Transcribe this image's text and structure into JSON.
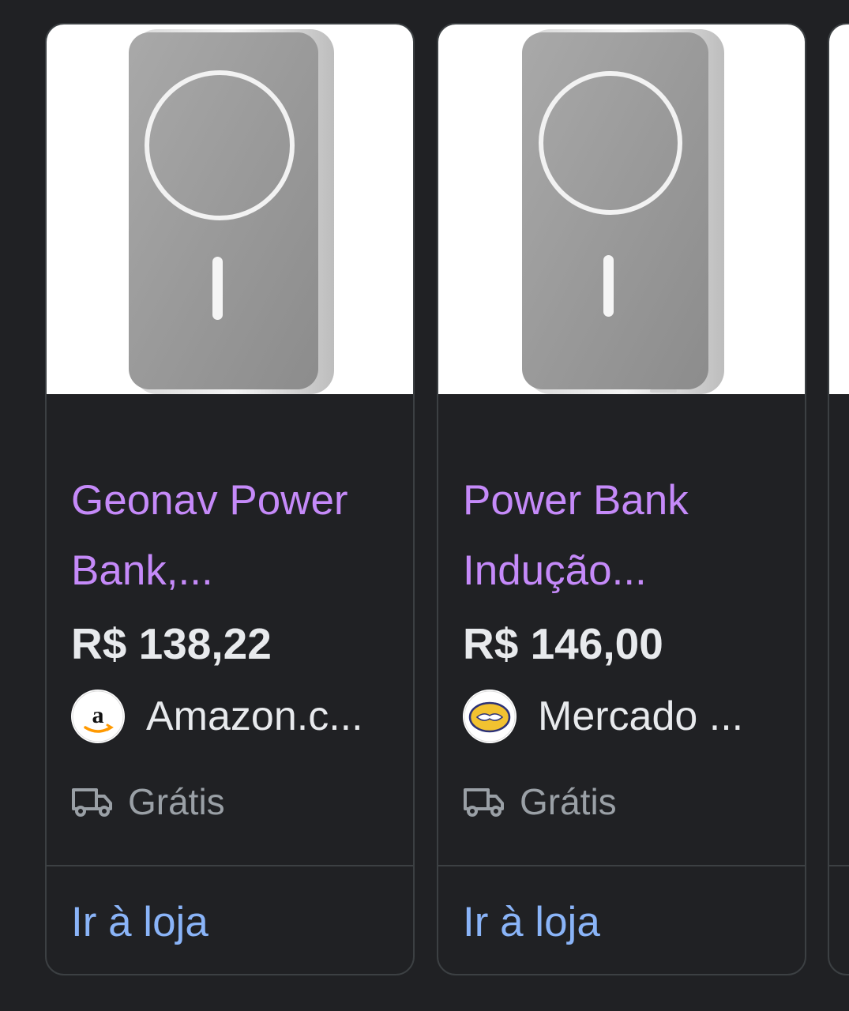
{
  "products": [
    {
      "title_line1": "Geonav Power",
      "title_line2": "Bank,...",
      "price": "R$ 138,22",
      "merchant": "Amazon.c...",
      "merchant_logo": "amazon-logo",
      "shipping": "Grátis",
      "cta": "Ir à loja"
    },
    {
      "title_line1": "Power Bank",
      "title_line2": "Indução...",
      "price": "R$ 146,00",
      "merchant": "Mercado ...",
      "merchant_logo": "mercado-livre-logo",
      "shipping": "Grátis",
      "cta": "Ir à loja"
    }
  ],
  "colors": {
    "background": "#202124",
    "card_border": "#3c4043",
    "title": "#c58af9",
    "price": "#e8eaed",
    "secondary_text": "#9aa0a6",
    "link": "#8ab4f8"
  },
  "icons": {
    "shipping": "truck-icon"
  }
}
